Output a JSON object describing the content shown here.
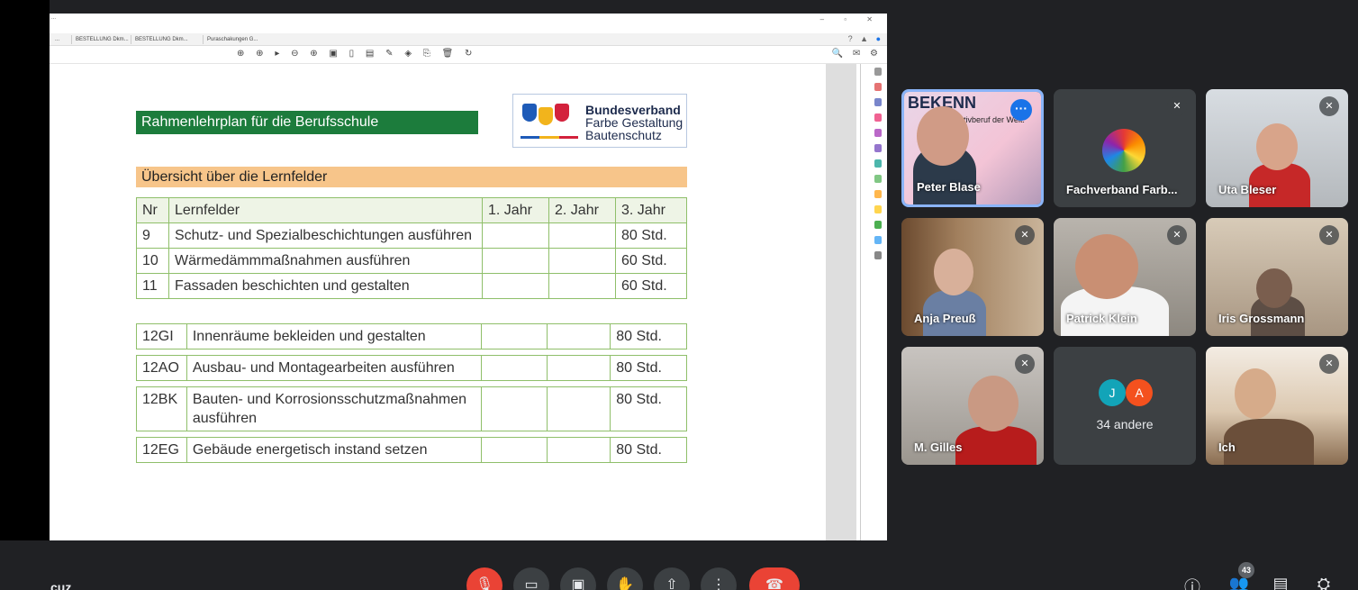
{
  "viewer": {
    "menu_line1": "...",
    "tabs": [
      "...",
      "BESTELLUNG Dkm...",
      "BESTELLUNG Dkm...",
      "Puraschakungen G..."
    ],
    "toolbar_icons": "⊕ ⊕ ▸ ⊖ ⊕ ▣ ▯ ▤ ✎ ◈ ⎘ 🗑 ↻",
    "right_icons": "🔍 ✉ ⚙"
  },
  "document": {
    "heading": "Rahmenlehrplan für die Berufsschule",
    "logo": {
      "line1": "Bundesverband",
      "line2": "Farbe Gestaltung",
      "line3": "Bautenschutz"
    },
    "section_title": "Übersicht über die Lernfelder",
    "table_header": {
      "nr": "Nr",
      "name": "Lernfelder",
      "y1": "1. Jahr",
      "y2": "2. Jahr",
      "y3": "3. Jahr"
    },
    "rows": [
      {
        "nr": "9",
        "name": "Schutz- und Spezialbeschichtungen ausführen",
        "y3": "80 Std."
      },
      {
        "nr": "10",
        "name": "Wärmedämmmaßnahmen ausführen",
        "y3": "60 Std."
      },
      {
        "nr": "11",
        "name": "Fassaden beschichten und gestalten",
        "y3": "60 Std."
      }
    ],
    "seg_rows": [
      {
        "nr": "12GI",
        "name": "Innenräume bekleiden und gestalten",
        "y3": "80 Std."
      },
      {
        "nr": "12AO",
        "name": "Ausbau- und Montagearbeiten ausführen",
        "y3": "80 Std."
      },
      {
        "nr": "12BK",
        "name": "Bauten- und Korrosionsschutzmaßnahmen ausführen",
        "y3": "80 Std."
      },
      {
        "nr": "12EG",
        "name": "Gebäude energetisch instand setzen",
        "y3": "80 Std."
      }
    ]
  },
  "participants": [
    {
      "name": "Peter Blase",
      "banner": "BEKENN",
      "banner_sub": "tivberuf der Welt.",
      "active": true
    },
    {
      "name": "Fachverband Farb..."
    },
    {
      "name": "Uta Bleser"
    },
    {
      "name": "Anja Preuß"
    },
    {
      "name": "Patrick Klein"
    },
    {
      "name": "Iris Grossmann"
    },
    {
      "name": "M. Gilles"
    },
    {
      "name": "34 andere",
      "avatars": [
        "J",
        "A"
      ]
    },
    {
      "name": "Ich"
    }
  ],
  "controls": {
    "meeting_name": "cuz",
    "people_count": "43",
    "icons": [
      "mic-off",
      "camera",
      "captions",
      "raise-hand",
      "present",
      "more",
      "hang-up"
    ]
  },
  "colors": {
    "accent": "#1a73e8",
    "danger": "#ea4335",
    "doc_green": "#1c7c3c",
    "doc_orange": "#f7c58a"
  }
}
